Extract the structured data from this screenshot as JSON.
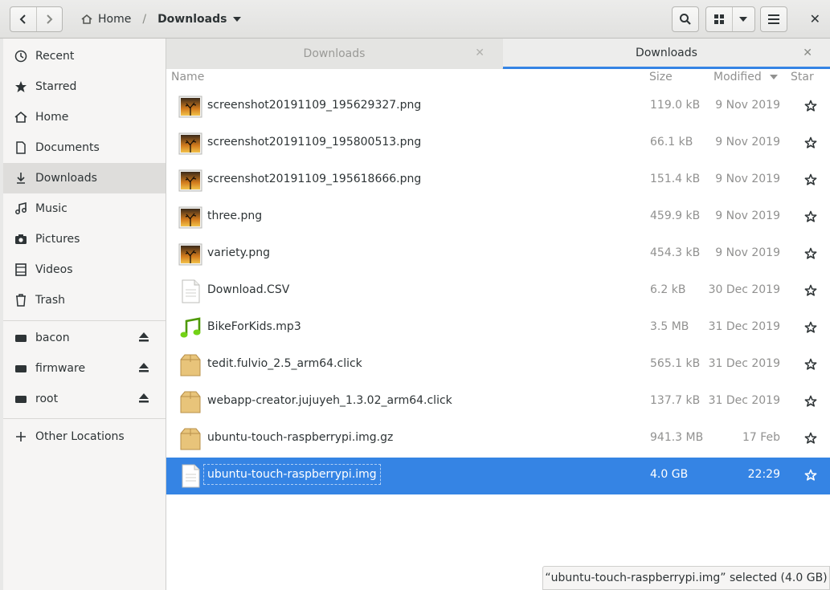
{
  "header": {
    "breadcrumbs": [
      {
        "label": "Home"
      },
      {
        "label": "Downloads"
      }
    ],
    "close_label": "✕"
  },
  "sidebar": {
    "items": [
      {
        "label": "Recent",
        "icon": "clock-icon"
      },
      {
        "label": "Starred",
        "icon": "star-icon"
      },
      {
        "label": "Home",
        "icon": "home-icon"
      },
      {
        "label": "Documents",
        "icon": "document-icon"
      },
      {
        "label": "Downloads",
        "icon": "download-icon",
        "active": true
      },
      {
        "label": "Music",
        "icon": "music-icon"
      },
      {
        "label": "Pictures",
        "icon": "camera-icon"
      },
      {
        "label": "Videos",
        "icon": "film-icon"
      },
      {
        "label": "Trash",
        "icon": "trash-icon"
      }
    ],
    "devices": [
      {
        "label": "bacon",
        "icon": "drive-icon"
      },
      {
        "label": "firmware",
        "icon": "drive-icon"
      },
      {
        "label": "root",
        "icon": "drive-icon"
      }
    ],
    "other_locations": "Other Locations"
  },
  "tabs": [
    {
      "label": "Downloads",
      "active": false
    },
    {
      "label": "Downloads",
      "active": true
    }
  ],
  "columns": {
    "name": "Name",
    "size": "Size",
    "modified": "Modified",
    "star": "Star"
  },
  "files": [
    {
      "name": "screenshot20191109_195629327.png",
      "size": "119.0 kB",
      "modified": "9 Nov 2019",
      "type": "image"
    },
    {
      "name": "screenshot20191109_195800513.png",
      "size": "66.1 kB",
      "modified": "9 Nov 2019",
      "type": "image"
    },
    {
      "name": "screenshot20191109_195618666.png",
      "size": "151.4 kB",
      "modified": "9 Nov 2019",
      "type": "image"
    },
    {
      "name": "three.png",
      "size": "459.9 kB",
      "modified": "9 Nov 2019",
      "type": "image"
    },
    {
      "name": "variety.png",
      "size": "454.3 kB",
      "modified": "9 Nov 2019",
      "type": "image"
    },
    {
      "name": "Download.CSV",
      "size": "6.2 kB",
      "modified": "30 Dec 2019",
      "type": "text"
    },
    {
      "name": "BikeForKids.mp3",
      "size": "3.5 MB",
      "modified": "31 Dec 2019",
      "type": "audio"
    },
    {
      "name": "tedit.fulvio_2.5_arm64.click",
      "size": "565.1 kB",
      "modified": "31 Dec 2019",
      "type": "package"
    },
    {
      "name": "webapp-creator.jujuyeh_1.3.02_arm64.click",
      "size": "137.7 kB",
      "modified": "31 Dec 2019",
      "type": "package"
    },
    {
      "name": "ubuntu-touch-raspberrypi.img.gz",
      "size": "941.3 MB",
      "modified": "17 Feb",
      "type": "package"
    },
    {
      "name": "ubuntu-touch-raspberrypi.img",
      "size": "4.0 GB",
      "modified": "22:29",
      "type": "text",
      "selected": true
    }
  ],
  "status": "“ubuntu-touch-raspberrypi.img” selected  (4.0 GB)",
  "colors": {
    "accent": "#3584e4",
    "sidebar_bg": "#f6f5f4"
  }
}
